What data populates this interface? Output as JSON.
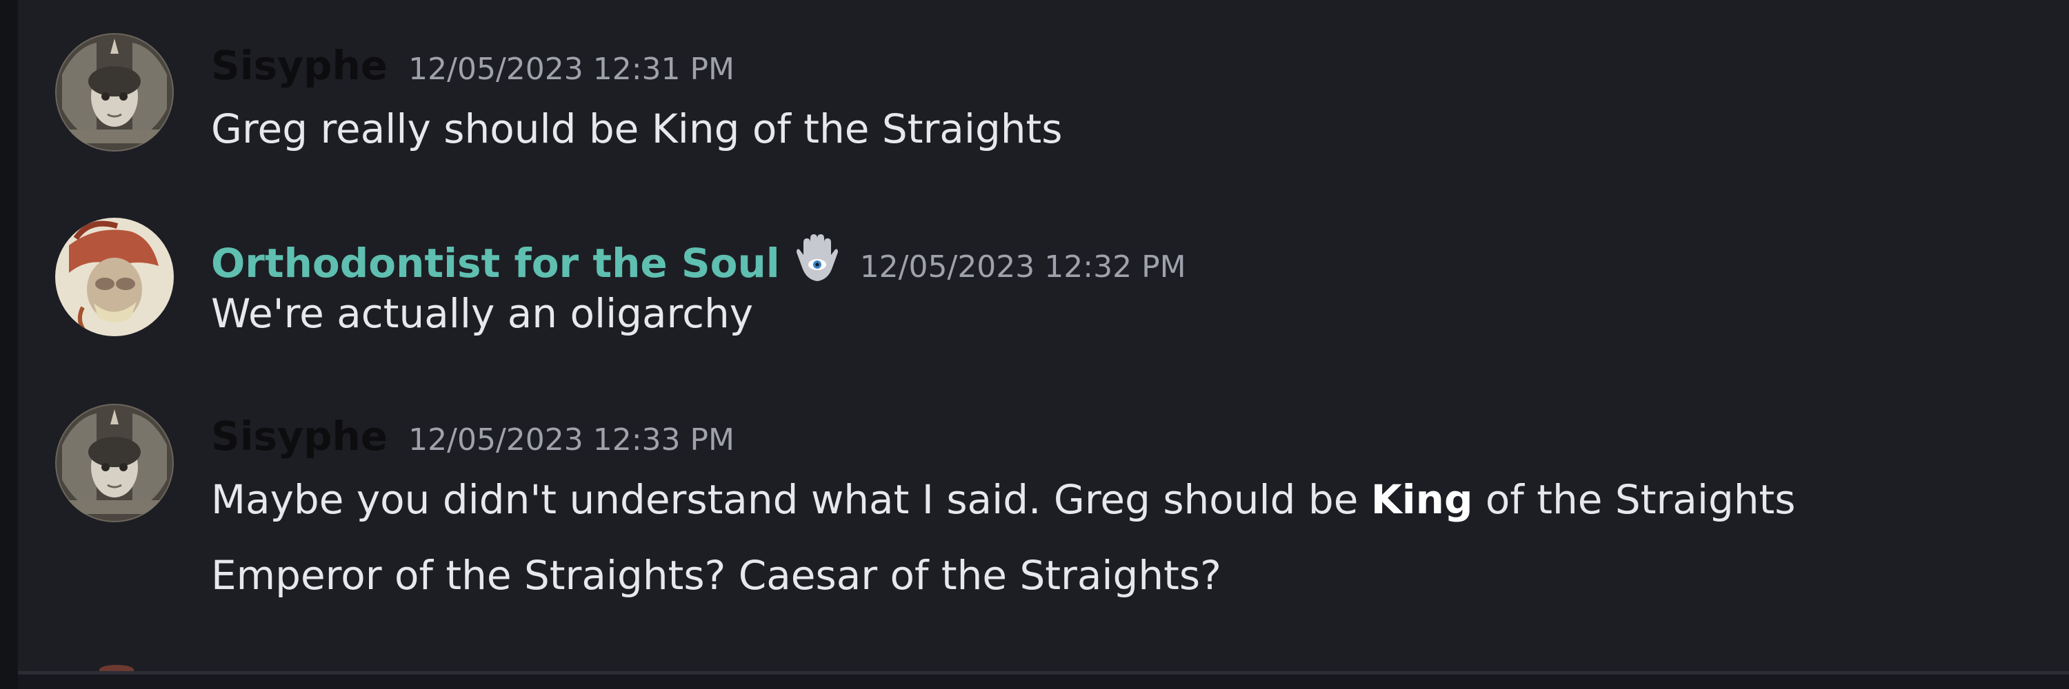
{
  "colors": {
    "background": "#1d1e24",
    "message_text": "#e7e8ec",
    "timestamp": "#a0a2ab",
    "sisyphe_name": "#0d0d10",
    "orthodontist_name": "#5fbfb0"
  },
  "messages": [
    {
      "author": "Sisyphe",
      "avatar_icon": "sisyphe-avatar",
      "timestamp": "12/05/2023 12:31 PM",
      "lines": [
        "Greg really should be King of the Straights"
      ]
    },
    {
      "author": "Orthodontist for the Soul",
      "avatar_icon": "orthodontist-avatar",
      "badge_icon": "hamsa-icon",
      "timestamp": "12/05/2023 12:32 PM",
      "lines": [
        "We're actually an oligarchy"
      ]
    },
    {
      "author": "Sisyphe",
      "avatar_icon": "sisyphe-avatar",
      "timestamp": "12/05/2023 12:33 PM",
      "lines": [
        {
          "before": "Maybe you didn't understand what I said. Greg should be ",
          "bold": "King",
          "after": " of the Straights"
        },
        "Emperor of the Straights? Caesar of the Straights?"
      ]
    }
  ]
}
